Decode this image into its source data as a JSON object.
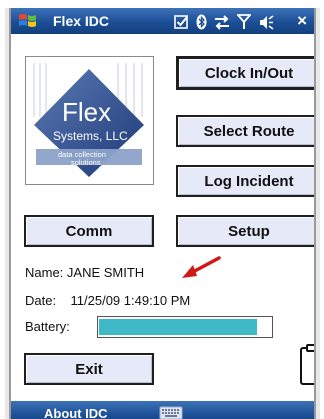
{
  "titlebar": {
    "app_title": "Flex IDC",
    "close_label": "×",
    "icons": [
      "windows-flag-icon",
      "notification-check-icon",
      "bluetooth-icon",
      "connectivity-arrows-icon",
      "signal-icon",
      "volume-icon"
    ]
  },
  "logo": {
    "brand": "Flex",
    "company": "Systems, LLC",
    "tagline_line1": "data collection",
    "tagline_line2": "solutions"
  },
  "buttons": {
    "clock": "Clock In/Out",
    "route": "Select Route",
    "incident": "Log Incident",
    "comm": "Comm",
    "setup": "Setup",
    "exit": "Exit"
  },
  "info": {
    "name_line": "Name: JANE SMITH",
    "date_line": "Date:    11/25/09 1:49:10 PM",
    "battery_label": "Battery:",
    "battery_level": 0.92
  },
  "colors": {
    "accent_arrow": "#d01818",
    "battery_fill": "#3fb8c8",
    "titlebar": "#1c4f96",
    "button_face": "#e6e9f8"
  },
  "menubar": {
    "about_label": "About IDC",
    "keyboard_icon": "keyboard-icon"
  }
}
